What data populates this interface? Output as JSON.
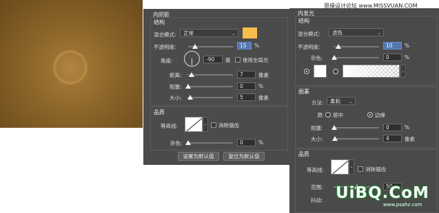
{
  "watermark": {
    "top": "思缘设计论坛  www.MISSVUAN.COM",
    "big": "UiBQ.CoM",
    "small": "www.psahz.com"
  },
  "inner_shadow": {
    "title": "内阴影",
    "structure": {
      "title": "结构",
      "blend_label": "混合模式:",
      "blend_value": "正常",
      "color": "#f7bd4a",
      "opacity_label": "不透明度:",
      "opacity_value": "15",
      "opacity_unit": "%",
      "opacity_level": 0.15,
      "angle_label": "角度:",
      "angle_value": "-90",
      "angle_unit": "度",
      "global_light_label": "使用全局光",
      "global_light_checked": false,
      "distance_label": "距离:",
      "distance_value": "7",
      "distance_unit": "像素",
      "choke_label": "阻塞:",
      "choke_value": "0",
      "choke_unit": "%",
      "size_label": "大小:",
      "size_value": "5",
      "size_unit": "像素"
    },
    "quality": {
      "title": "品质",
      "contour_label": "等高线:",
      "antialias_label": "消除锯齿",
      "noise_label": "杂色:",
      "noise_value": "0",
      "noise_unit": "%"
    },
    "buttons": {
      "default_set": "设置为默认值",
      "default_reset": "复位为默认值"
    }
  },
  "outer_glow": {
    "title": "内发光",
    "structure": {
      "title": "结构",
      "blend_label": "混合模式:",
      "blend_value": "滤色",
      "opacity_label": "不透明度:",
      "opacity_value": "10",
      "opacity_unit": "%",
      "noise_label": "杂色:",
      "noise_value": "0",
      "noise_unit": "%",
      "solid_color": "#ffffff"
    },
    "elements": {
      "title": "图素",
      "method_label": "方法:",
      "method_value": "柔和",
      "source_label": "源:",
      "source_center": "居中",
      "source_edge": "边缘",
      "choke_label": "阻塞:",
      "choke_value": "0",
      "choke_unit": "%",
      "size_label": "大小:",
      "size_value": "4",
      "size_unit": "像素"
    },
    "quality": {
      "title": "品质",
      "contour_label": "等高线:",
      "antialias_label": "消除锯齿",
      "range_label": "范围:",
      "range_value": "50",
      "jitter_label": "抖动:"
    }
  }
}
